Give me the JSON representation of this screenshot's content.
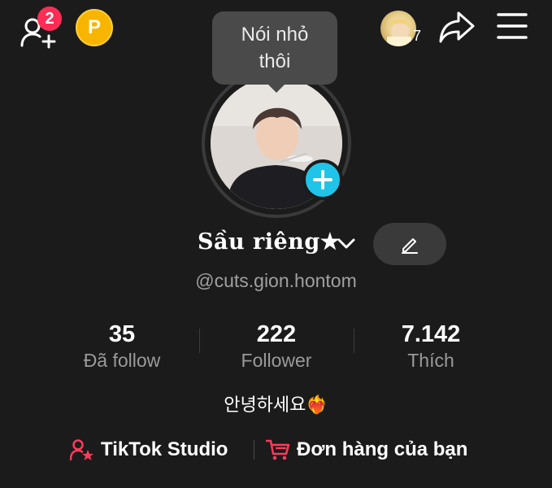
{
  "header": {
    "friend_requests_count": "2",
    "coin_label": "P",
    "story_count": "7"
  },
  "tooltip": {
    "line1": "Nói nhỏ",
    "line2": "thôi"
  },
  "profile": {
    "display_name": "Sầu riêng★",
    "username": "@cuts.gion.hontom",
    "bio": "안녕하세요❤️‍🔥"
  },
  "stats": [
    {
      "value": "35",
      "label": "Đã follow"
    },
    {
      "value": "222",
      "label": "Follower"
    },
    {
      "value": "7.142",
      "label": "Thích"
    }
  ],
  "links": {
    "studio": "TikTok Studio",
    "orders": "Đơn hàng của bạn"
  },
  "colors": {
    "background": "#1b1b1b",
    "badge": "#ff2d55",
    "accent_cyan": "#20c4e8",
    "coin": "#f7b500"
  }
}
